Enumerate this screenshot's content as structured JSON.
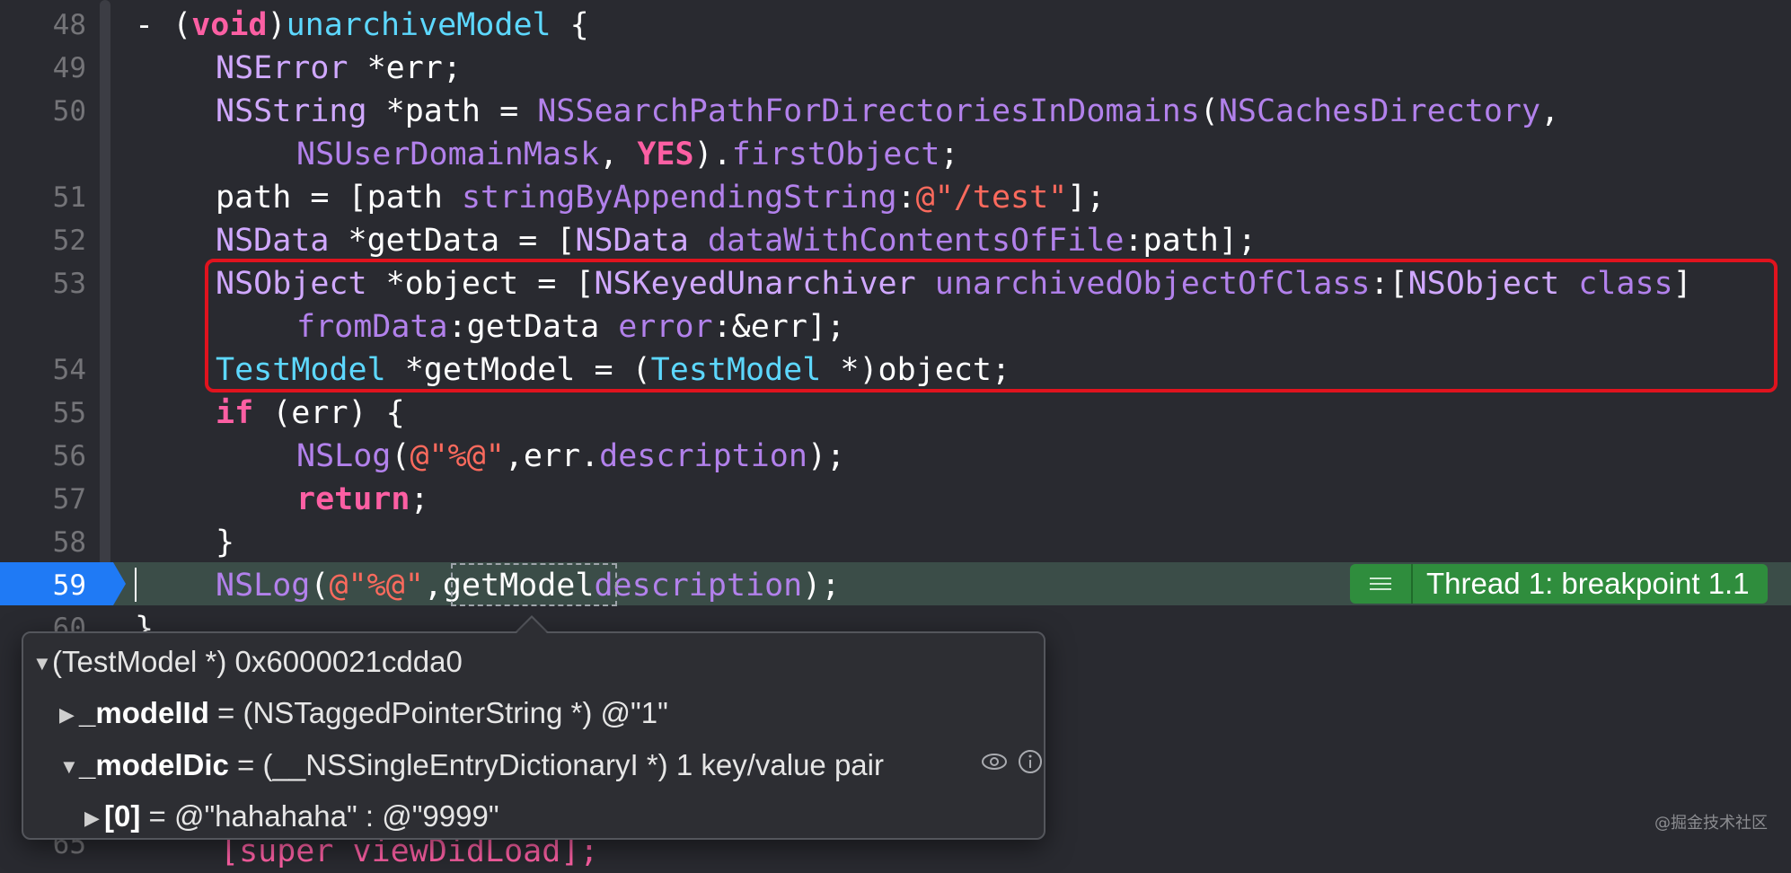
{
  "line_numbers": [
    "48",
    "49",
    "50",
    "51",
    "52",
    "53",
    "54",
    "55",
    "56",
    "57",
    "58",
    "59",
    "60",
    "65"
  ],
  "code_lines": {
    "l48": {
      "dash": "- (",
      "kw": "void",
      ")": ")",
      "name": "unarchiveModel",
      " brace": " {"
    },
    "l49": {
      "type": "NSError",
      "rest": " *err;"
    },
    "l50a": {
      "type": "NSString",
      "r1": " *path = ",
      "fn": "NSSearchPathForDirectoriesInDomains",
      "p": "(",
      "arg": "NSCachesDirectory",
      ",": ","
    },
    "l50b": {
      "arg": "NSUserDomainMask",
      ",": ", ",
      "kw": "YES",
      "r": ").",
      "prop": "firstObject",
      ";": ";"
    },
    "l51": {
      "r1": "path = [path ",
      "msg": "stringByAppendingString",
      ":": ":",
      "str": "@\"/test\"",
      "end": "];"
    },
    "l52": {
      "type": "NSData",
      "r1": " *getData = [",
      "type2": "NSData",
      " ": " ",
      "msg": "dataWithContentsOfFile",
      "end": ":path];"
    },
    "l53a": {
      "type": "NSObject",
      "r1": " *object = [",
      "type2": "NSKeyedUnarchiver",
      " ": " ",
      "msg": "unarchivedObjectOfClass",
      "r2": ":[",
      "type3": "NSObject",
      " 2": " ",
      "cls": "class",
      "end": "]"
    },
    "l53b": {
      "msg": "fromData",
      "r1": ":getData ",
      "msg2": "error",
      "end": ":&err];"
    },
    "l54": {
      "type": "TestModel",
      "r1": " *getModel = (",
      "type2": "TestModel",
      "end": " *)object;"
    },
    "l55": {
      "kw": "if",
      "end": " (err) {"
    },
    "l56": {
      "fn": "NSLog",
      "p": "(",
      "str": "@\"%@\"",
      "r1": ",err.",
      "prop": "description",
      "end": ");"
    },
    "l57": {
      "kw": "return",
      "end": ";"
    },
    "l58": {
      "end": "}"
    },
    "l59": {
      "fn": "NSLog",
      "p": "(",
      "str": "@\"%@\"",
      "r1": ",",
      "var": "getModel",
      ".": ".",
      "prop": "description",
      "end": ");"
    },
    "l60": {
      "end": "}"
    },
    "l65": {
      "text": "[super viewDidLoad];"
    }
  },
  "thread_badge": {
    "icon": "list-icon",
    "label": "Thread 1: breakpoint 1.1"
  },
  "popover": {
    "root": "(TestModel *) 0x6000021cdda0",
    "row1_name": "_modelId",
    "row1_value": " = (NSTaggedPointerString *) @\"1\"",
    "row2_name": "_modelDic",
    "row2_value": " = (__NSSingleEntryDictionaryI *) 1 key/value pair",
    "row3_name": "[0]",
    "row3_value": " = @\"hahahaha\" : @\"9999\""
  },
  "watermark": "@掘金技术社区",
  "colors": {
    "background": "#292a30",
    "highlight": "#3b4d48",
    "breakpoint": "#1f7af5",
    "badge": "#2f8d3d",
    "redbox": "#e0131e"
  }
}
